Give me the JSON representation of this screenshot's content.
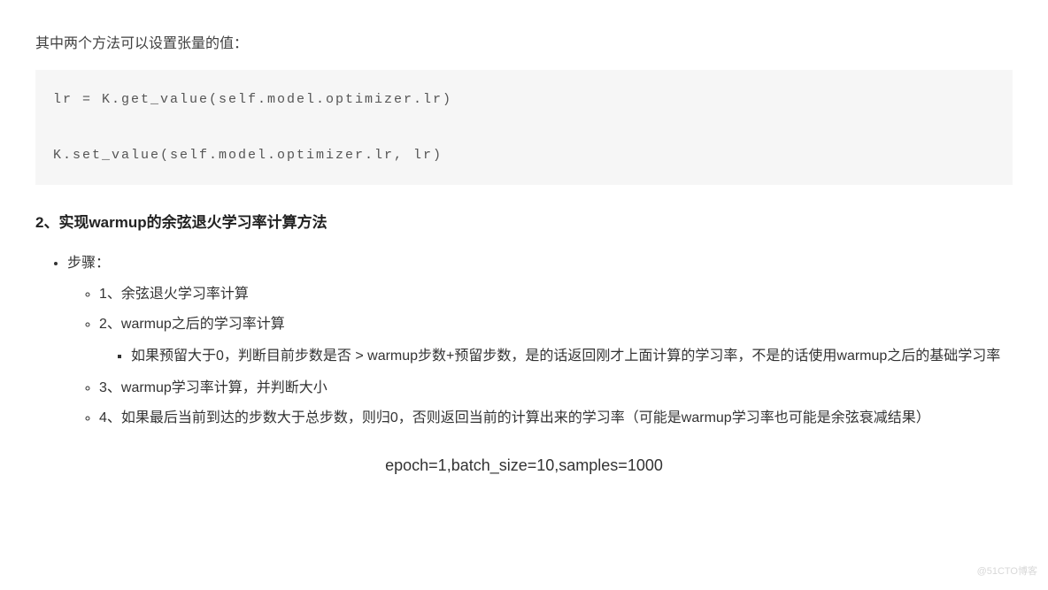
{
  "intro": "其中两个方法可以设置张量的值：",
  "code": "lr = K.get_value(self.model.optimizer.lr)\n\nK.set_value(self.model.optimizer.lr, lr)",
  "heading": "2、实现warmup的余弦退火学习率计算方法",
  "steps_label": "步骤：",
  "steps": {
    "s1": "1、余弦退火学习率计算",
    "s2": "2、warmup之后的学习率计算",
    "s2_detail": "如果预留大于0，判断目前步数是否 > warmup步数+预留步数，是的话返回刚才上面计算的学习率，不是的话使用warmup之后的基础学习率",
    "s3": "3、warmup学习率计算，并判断大小",
    "s4": "4、如果最后当前到达的步数大于总步数，则归0，否则返回当前的计算出来的学习率（可能是warmup学习率也可能是余弦衰减结果）"
  },
  "caption": "epoch=1,batch_size=10,samples=1000",
  "watermark": "@51CTO博客"
}
